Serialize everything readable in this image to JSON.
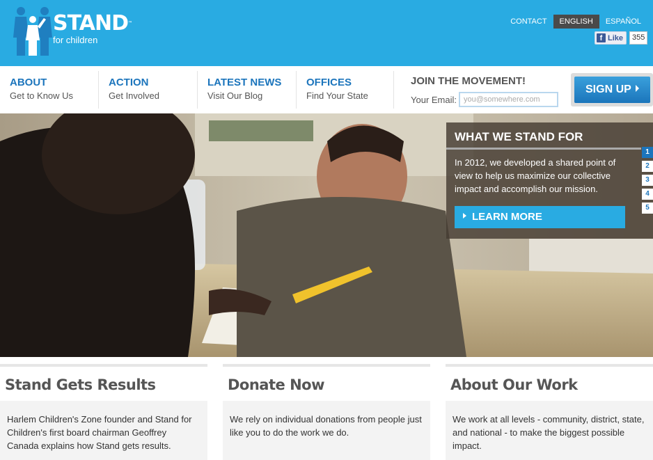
{
  "brand": {
    "name": "STAND",
    "tm": "™",
    "sub": "for children",
    "color": "#29abe2"
  },
  "top_links": [
    {
      "label": "CONTACT"
    },
    {
      "label": "ENGLISH"
    },
    {
      "label": "ESPAÑOL"
    }
  ],
  "facebook": {
    "icon": "f",
    "label": "Like",
    "count": "355"
  },
  "nav": [
    {
      "title": "ABOUT",
      "sub": "Get to Know Us"
    },
    {
      "title": "ACTION",
      "sub": "Get Involved"
    },
    {
      "title": "LATEST NEWS",
      "sub": "Visit Our Blog"
    },
    {
      "title": "OFFICES",
      "sub": "Find Your State"
    }
  ],
  "join": {
    "title": "JOIN THE MOVEMENT!",
    "email_label": "Your Email:",
    "email_placeholder": "you@somewhere.com",
    "signup_label": "SIGN UP"
  },
  "feature": {
    "title": "WHAT WE STAND FOR",
    "text": "In 2012, we developed a shared point of view to help us maximize our collective impact and accomplish our mission.",
    "button": "LEARN MORE",
    "pages": [
      "1",
      "2",
      "3",
      "4",
      "5"
    ],
    "active_page": "1"
  },
  "columns": [
    {
      "title": "Stand Gets Results",
      "body": "Harlem Children's Zone founder and Stand for Children's first board chairman Geoffrey Canada explains how Stand gets results."
    },
    {
      "title": "Donate Now",
      "body": "We rely on individual donations from people just like you to do the work we do."
    },
    {
      "title": "About Our Work",
      "body": "We work at all levels - community, district, state, and national - to make the biggest possible impact."
    }
  ]
}
